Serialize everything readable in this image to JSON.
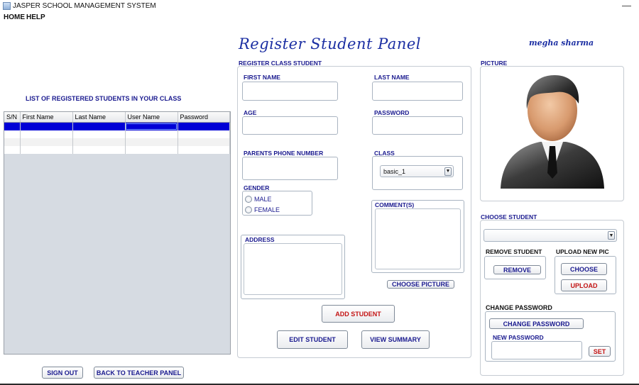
{
  "window": {
    "title": "JASPER SCHOOL MANAGEMENT SYSTEM",
    "minimize": "—"
  },
  "menu": {
    "home": "HOME",
    "help": "HELP"
  },
  "header": {
    "panel_title": "Register Student Panel",
    "user_name": "megha sharma"
  },
  "student_list": {
    "heading": "LIST OF REGISTERED STUDENTS IN YOUR CLASS",
    "columns": [
      "S/N",
      "First Name",
      "Last Name",
      "User Name",
      "Password"
    ]
  },
  "register": {
    "section_title": "REGISTER CLASS STUDENT",
    "first_name_label": "FIRST NAME",
    "last_name_label": "LAST NAME",
    "age_label": "AGE",
    "password_label": "PASSWORD",
    "parents_phone_label": "PARENTS PHONE NUMBER",
    "class_label": "CLASS",
    "class_value": "basic_1",
    "gender_label": "GENDER",
    "gender_male": "MALE",
    "gender_female": "FEMALE",
    "comments_label": "COMMENT(S)",
    "address_label": "ADDRESS",
    "choose_picture": "CHOOSE PICTURE",
    "add_student": "ADD STUDENT",
    "edit_student": "EDIT STUDENT",
    "view_summary": "VIEW SUMMARY"
  },
  "picture": {
    "label": "PICTURE"
  },
  "manage": {
    "choose_student_label": "CHOOSE STUDENT",
    "remove_student_label": "REMOVE STUDENT",
    "remove_button": "REMOVE",
    "upload_new_pic_label": "UPLOAD NEW PIC",
    "choose_button": "CHOOSE",
    "upload_button": "UPLOAD",
    "change_password_label": "CHANGE PASSWORD",
    "change_password_button": "CHANGE PASSWORD",
    "new_password_label": "NEW PASSWORD",
    "set_button": "SET"
  },
  "footer": {
    "sign_out": "SIGN OUT",
    "back_to_teacher": "BACK TO TEACHER PANEL"
  },
  "colors": {
    "accent_blue": "#1a1a8f",
    "danger_red": "#c41414",
    "selection_blue": "#0000d6"
  }
}
